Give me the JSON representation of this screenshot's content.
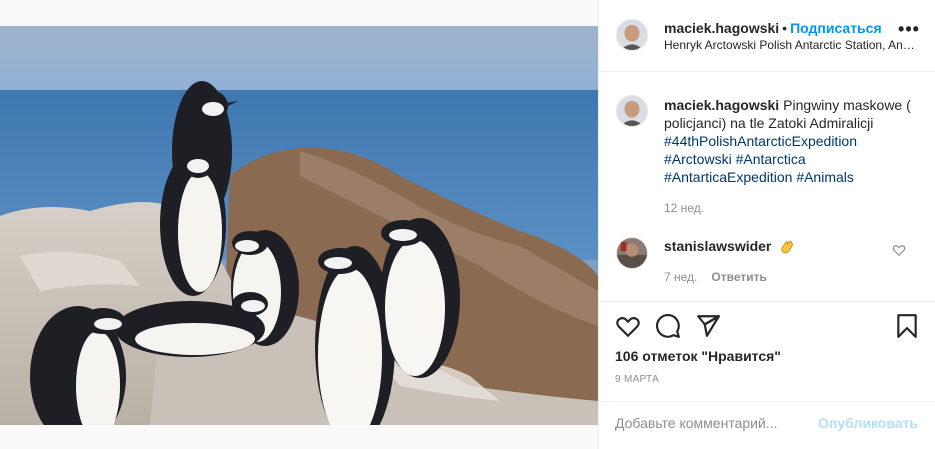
{
  "post": {
    "photo_alt": "chinstrap penguins on rocks by the sea",
    "header": {
      "username": "maciek.hagowski",
      "separator": "•",
      "follow_label": "Подписаться",
      "location": "Henryk Arctowski Polish Antarctic Station, Antarctica",
      "more_icon": "more-horizontal-icon",
      "more_label": "•••"
    },
    "caption": {
      "username": "maciek.hagowski",
      "text": "Pingwiny maskowe ( policjanci) na tle Zatoki Admiralicji",
      "hashtags": [
        "#44thPolishAntarcticExpedition",
        "#Arctowski",
        "#Antarctica",
        "#AntarticaExpedition",
        "#Animals"
      ],
      "time": "12 нед."
    },
    "comment": {
      "username": "stanislawswider",
      "emoji": "clapping-hands",
      "time": "7 нед.",
      "reply_label": "Ответить"
    },
    "actions": {
      "likes": "106 отметок \"Нравится\"",
      "date": "9 МАРТА"
    },
    "add_comment": {
      "placeholder": "Добавьте комментарий...",
      "publish_label": "Опубликовать"
    },
    "colors": {
      "link": "#0095f6",
      "hashtag": "#00376b",
      "muted": "#8e8e8e",
      "publish_disabled": "#b2dffc"
    }
  }
}
